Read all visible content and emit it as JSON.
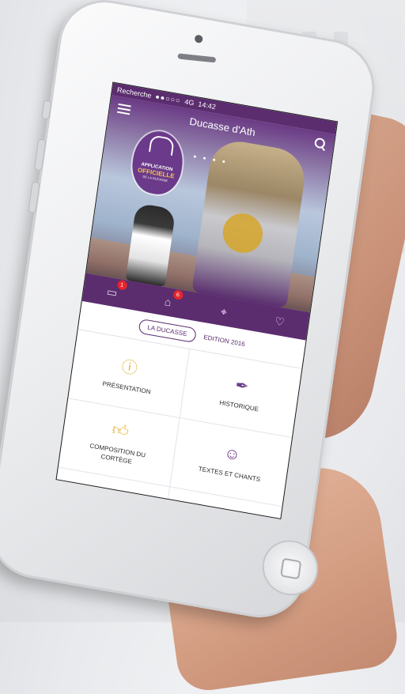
{
  "status": {
    "back_app": "Recherche",
    "signal": "●●○○○",
    "network": "4G",
    "time": "14:42"
  },
  "header": {
    "title": "Ducasse d'Ath"
  },
  "logo": {
    "line1": "APPLICATION",
    "line2": "OFFICIELLE",
    "line3": "DE LA DUCASSE"
  },
  "iconbar": {
    "news_count": "1",
    "bag_count": "6"
  },
  "tabs": [
    {
      "label": "LA DUCASSE",
      "active": true
    },
    {
      "label": "EDITION 2016",
      "active": false
    }
  ],
  "grid": [
    {
      "label": "PRÉSENTATION",
      "icon": "info-icon"
    },
    {
      "label": "HISTORIQUE",
      "icon": "quill-icon"
    },
    {
      "label": "COMPOSITION DU CORTÈGE",
      "icon": "thumbs-up-icon"
    },
    {
      "label": "TEXTES ET CHANTS",
      "icon": "theater-masks-icon"
    },
    {
      "label": "",
      "icon": "heart-icon"
    },
    {
      "label": "",
      "icon": "gears-icon"
    }
  ],
  "colors": {
    "brand_purple": "#5b2d6f",
    "accent_yellow": "#e7b43c",
    "badge_red": "#e8242c"
  }
}
